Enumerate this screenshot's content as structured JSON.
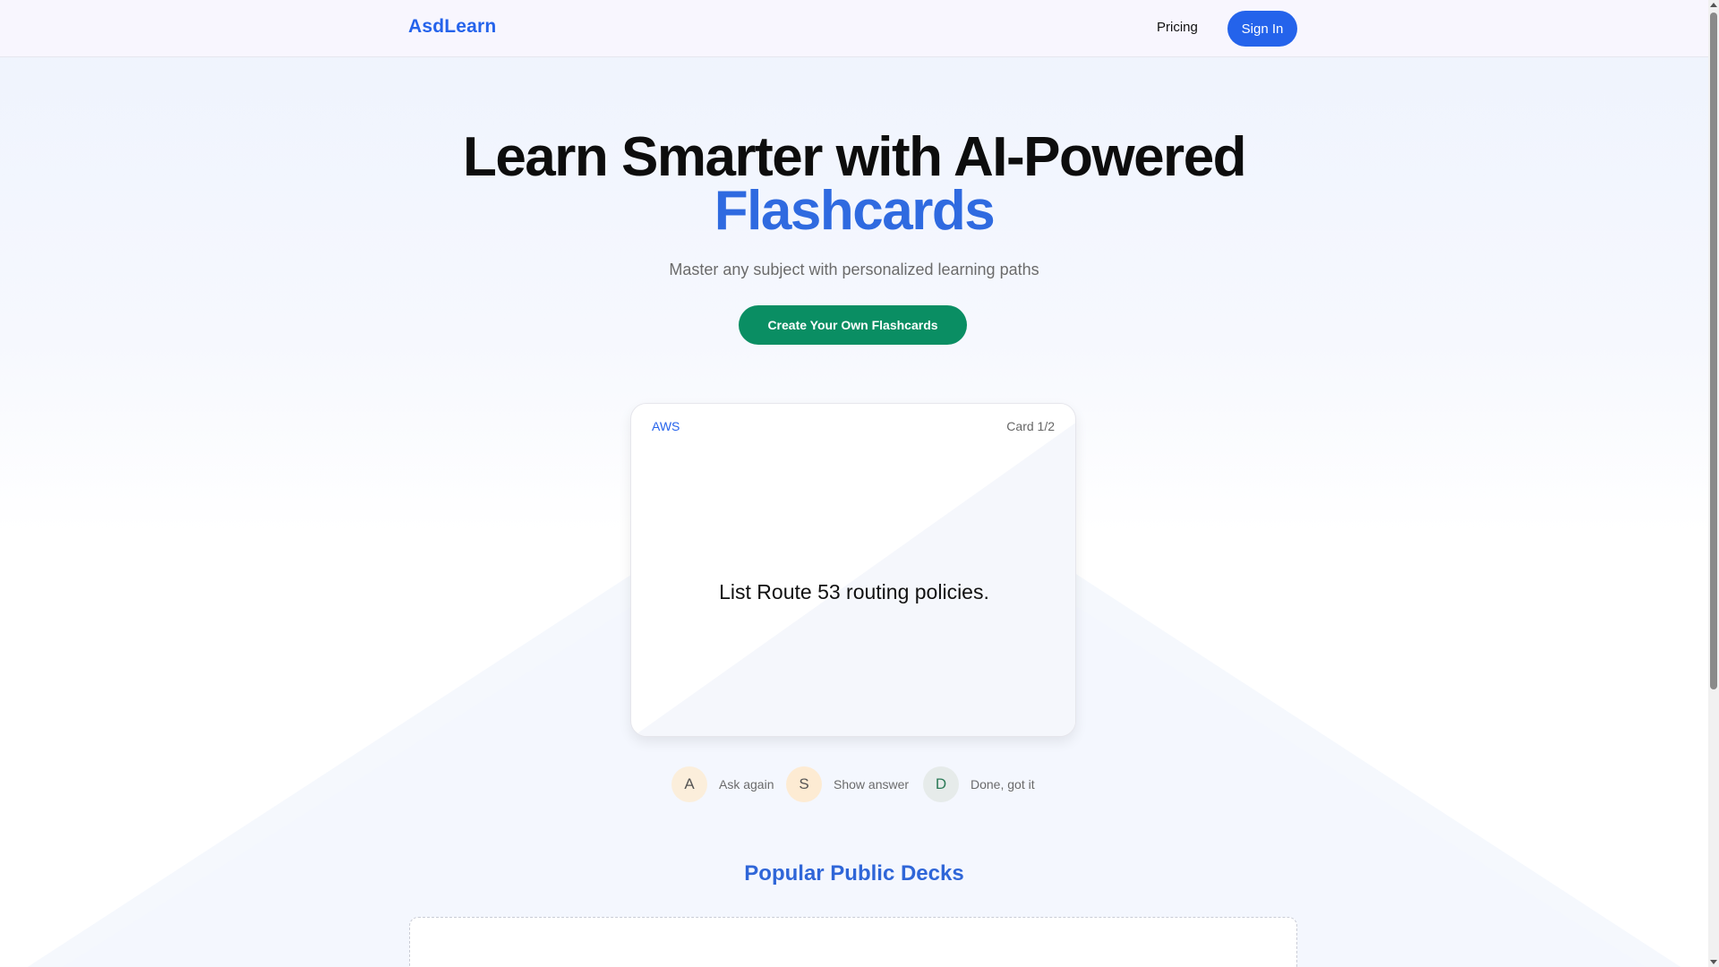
{
  "nav": {
    "brand": "AsdLearn",
    "pricing": "Pricing",
    "sign_in": "Sign In"
  },
  "hero": {
    "title_line1": "Learn Smarter with AI-Powered",
    "title_line2": "Flashcards",
    "subtitle": "Master any subject with personalized learning paths",
    "cta": "Create Your Own Flashcards"
  },
  "card": {
    "deck": "AWS",
    "counter": "Card 1/2",
    "question": "List Route 53 routing policies."
  },
  "shortcuts": [
    {
      "key": "A",
      "label": "Ask again",
      "bg": "#fbeedb",
      "fg": "#555555"
    },
    {
      "key": "S",
      "label": "Show answer",
      "bg": "#fdebd3",
      "fg": "#555555"
    },
    {
      "key": "D",
      "label": "Done, got it",
      "bg": "#e6ebea",
      "fg": "#2c7a57"
    }
  ],
  "section": {
    "popular_title": "Popular Public Decks"
  },
  "colors": {
    "accent": "#2563eb",
    "cta": "#0a8e63"
  }
}
